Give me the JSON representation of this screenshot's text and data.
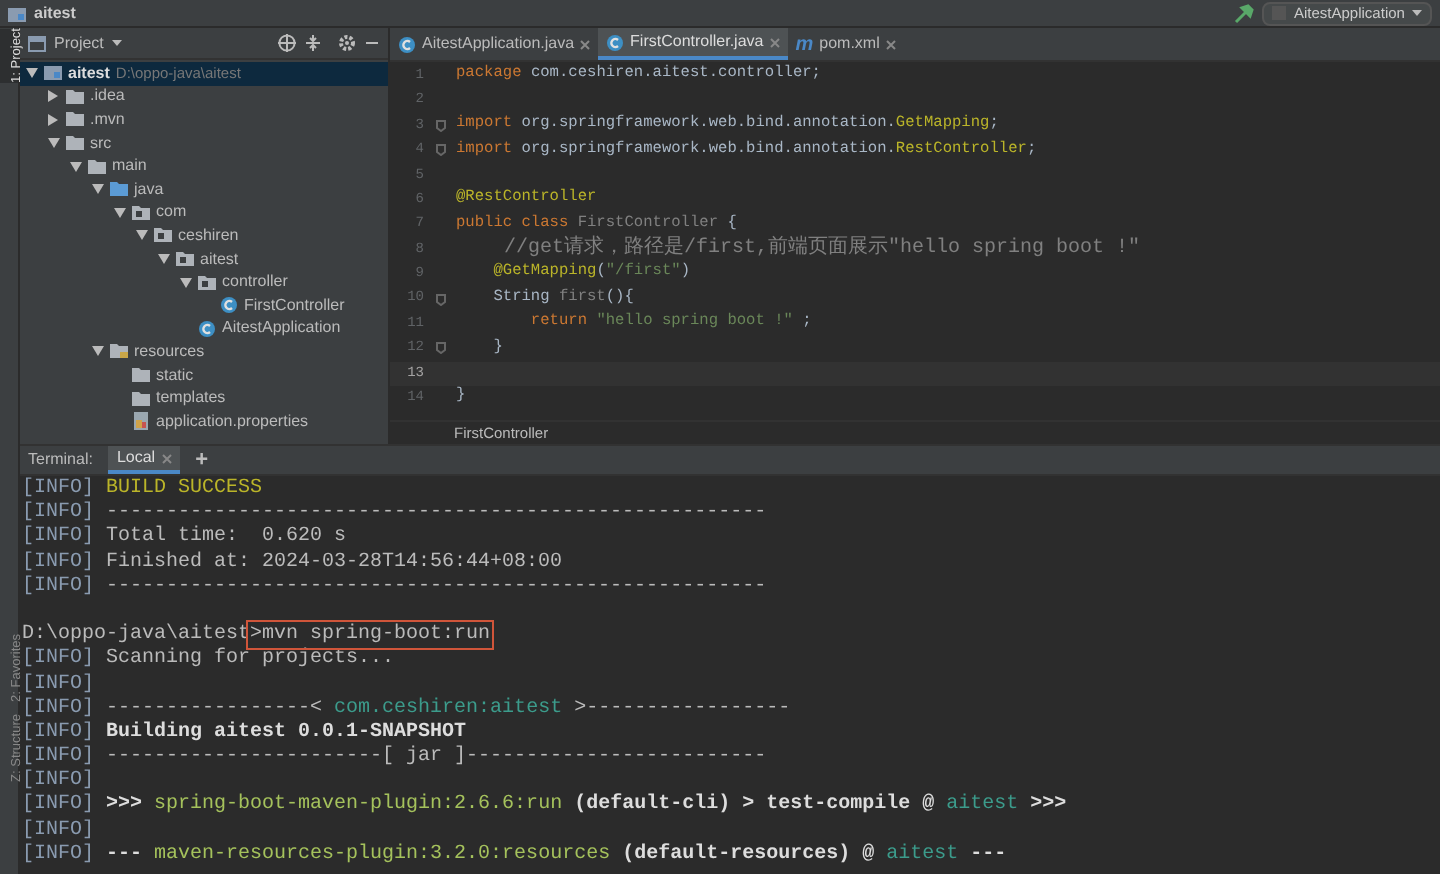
{
  "window": {
    "title": "aitest",
    "run_config": "AitestApplication"
  },
  "side_tabs": [
    {
      "label": "1: Project",
      "selected": true
    },
    {
      "label": "2: Favorites",
      "selected": false
    },
    {
      "label": "Z: Structure",
      "selected": false
    }
  ],
  "project_panel": {
    "title": "Project",
    "tree": [
      {
        "kind": "module",
        "label": "aitest",
        "path": "D:\\oppo-java\\aitest",
        "expanded": true,
        "selected": true,
        "children": [
          {
            "kind": "folder",
            "label": ".idea",
            "expanded": false,
            "selected": false
          },
          {
            "kind": "folder",
            "label": ".mvn",
            "expanded": false,
            "selected": false
          },
          {
            "kind": "folder",
            "label": "src",
            "expanded": true,
            "selected": false,
            "children": [
              {
                "kind": "folder",
                "label": "main",
                "expanded": true,
                "selected": false,
                "children": [
                  {
                    "kind": "source_folder",
                    "label": "java",
                    "expanded": true,
                    "selected": false,
                    "children": [
                      {
                        "kind": "package",
                        "label": "com",
                        "expanded": true,
                        "selected": false,
                        "children": [
                          {
                            "kind": "package",
                            "label": "ceshiren",
                            "expanded": true,
                            "selected": false,
                            "children": [
                              {
                                "kind": "package",
                                "label": "aitest",
                                "expanded": true,
                                "selected": false,
                                "children": [
                                  {
                                    "kind": "package",
                                    "label": "controller",
                                    "expanded": true,
                                    "selected": false,
                                    "children": [
                                      {
                                        "kind": "class",
                                        "label": "FirstController",
                                        "selected": false
                                      }
                                    ]
                                  },
                                  {
                                    "kind": "class",
                                    "label": "AitestApplication",
                                    "selected": false
                                  }
                                ]
                              }
                            ]
                          }
                        ]
                      }
                    ]
                  },
                  {
                    "kind": "resources_folder",
                    "label": "resources",
                    "expanded": true,
                    "selected": false,
                    "children": [
                      {
                        "kind": "folder",
                        "label": "static",
                        "selected": false
                      },
                      {
                        "kind": "folder",
                        "label": "templates",
                        "selected": false
                      },
                      {
                        "kind": "properties",
                        "label": "application.properties",
                        "selected": false
                      }
                    ]
                  }
                ]
              }
            ]
          }
        ]
      }
    ]
  },
  "editor": {
    "tabs": [
      {
        "kind": "class",
        "label": "AitestApplication.java",
        "selected": false
      },
      {
        "kind": "class",
        "label": "FirstController.java",
        "selected": true
      },
      {
        "kind": "maven",
        "glyph": "m",
        "label": "pom.xml",
        "selected": false
      }
    ],
    "lines": [
      {
        "number": "1",
        "current": false,
        "tokens": [
          {
            "kind": "keyword",
            "text": "package "
          },
          {
            "kind": "plain",
            "text": "com.ceshiren.aitest.controller;"
          }
        ]
      },
      {
        "number": "2",
        "current": false
      },
      {
        "number": "3",
        "current": false,
        "fold": true,
        "tokens": [
          {
            "kind": "keyword",
            "text": "import "
          },
          {
            "kind": "plain",
            "text": "org.springframework.web.bind.annotation."
          },
          {
            "kind": "annotation",
            "text": "GetMapping"
          },
          {
            "kind": "plain",
            "text": ";"
          }
        ]
      },
      {
        "number": "4",
        "current": false,
        "fold": true,
        "tokens": [
          {
            "kind": "keyword",
            "text": "import "
          },
          {
            "kind": "plain",
            "text": "org.springframework.web.bind.annotation."
          },
          {
            "kind": "annotation",
            "text": "RestController"
          },
          {
            "kind": "plain",
            "text": ";"
          }
        ]
      },
      {
        "number": "5",
        "current": false
      },
      {
        "number": "6",
        "current": false,
        "tokens": [
          {
            "kind": "annotation",
            "text": "@RestController"
          }
        ]
      },
      {
        "number": "7",
        "current": false,
        "tokens": [
          {
            "kind": "keyword",
            "text": "public class "
          },
          {
            "kind": "unused",
            "text": "FirstController "
          },
          {
            "kind": "plain",
            "text": "{"
          }
        ]
      },
      {
        "number": "8",
        "current": false,
        "tokens": [
          {
            "kind": "comment",
            "text": "    //get请求，路径是/first,前端页面展示\"hello spring boot !\""
          }
        ]
      },
      {
        "number": "9",
        "current": false,
        "tokens": [
          {
            "kind": "annotation",
            "text": "    @GetMapping"
          },
          {
            "kind": "plain",
            "text": "("
          },
          {
            "kind": "string",
            "text": "\"/first\""
          },
          {
            "kind": "plain",
            "text": ")"
          }
        ]
      },
      {
        "number": "10",
        "current": false,
        "fold": true,
        "tokens": [
          {
            "kind": "plain",
            "text": "    String "
          },
          {
            "kind": "unused",
            "text": "first"
          },
          {
            "kind": "plain",
            "text": "(){"
          }
        ]
      },
      {
        "number": "11",
        "current": false,
        "tokens": [
          {
            "kind": "keyword",
            "text": "        return "
          },
          {
            "kind": "string",
            "text": "\"hello spring boot !\""
          },
          {
            "kind": "plain",
            "text": " ;"
          }
        ]
      },
      {
        "number": "12",
        "current": false,
        "fold": true,
        "tokens": [
          {
            "kind": "plain",
            "text": "    }"
          }
        ]
      },
      {
        "number": "13",
        "current": true
      },
      {
        "number": "14",
        "current": false,
        "tokens": [
          {
            "kind": "plain",
            "text": "}"
          }
        ]
      }
    ],
    "breadcrumb": "FirstController"
  },
  "terminal": {
    "label": "Terminal:",
    "tabs": [
      {
        "label": "Local",
        "selected": true
      }
    ],
    "add": "+",
    "lines": [
      [
        {
          "kind": "info",
          "text": "[INFO]"
        },
        {
          "kind": "success",
          "text": " BUILD SUCCESS"
        }
      ],
      [
        {
          "kind": "info",
          "text": "[INFO]"
        },
        {
          "kind": "plain",
          "text": " -------------------------------------------------------"
        }
      ],
      [
        {
          "kind": "info",
          "text": "[INFO]"
        },
        {
          "kind": "plain",
          "text": " Total time:  0.620 s"
        }
      ],
      [
        {
          "kind": "info",
          "text": "[INFO]"
        },
        {
          "kind": "plain",
          "text": " Finished at: 2024-03-28T14:56:44+08:00"
        }
      ],
      [
        {
          "kind": "info",
          "text": "[INFO]"
        },
        {
          "kind": "plain",
          "text": " -------------------------------------------------------"
        }
      ],
      [
        {
          "kind": "blank"
        }
      ],
      [
        {
          "kind": "plain",
          "text": "D:\\oppo-java\\aitest"
        },
        {
          "kind": "boxed",
          "text": ">mvn spring-boot:run"
        }
      ],
      [
        {
          "kind": "info",
          "text": "[INFO]"
        },
        {
          "kind": "plain",
          "text": " Scanning for projects..."
        }
      ],
      [
        {
          "kind": "info",
          "text": "[INFO]"
        }
      ],
      [
        {
          "kind": "info",
          "text": "[INFO]"
        },
        {
          "kind": "plain",
          "text": " -----------------< "
        },
        {
          "kind": "module",
          "text": "com.ceshiren:aitest"
        },
        {
          "kind": "plain",
          "text": " >-----------------"
        }
      ],
      [
        {
          "kind": "info",
          "text": "[INFO]"
        },
        {
          "kind": "bold",
          "text": " Building aitest 0.0.1-SNAPSHOT"
        }
      ],
      [
        {
          "kind": "info",
          "text": "[INFO]"
        },
        {
          "kind": "plain",
          "text": " -----------------------[ jar ]-------------------------"
        }
      ],
      [
        {
          "kind": "info",
          "text": "[INFO]"
        }
      ],
      [
        {
          "kind": "info",
          "text": "[INFO]"
        },
        {
          "kind": "bold",
          "text": " >>> "
        },
        {
          "kind": "plugin",
          "text": "spring-boot-maven-plugin:2.6.6:run"
        },
        {
          "kind": "bold",
          "text": " (default-cli) > test-compile @ "
        },
        {
          "kind": "module",
          "text": "aitest"
        },
        {
          "kind": "bold",
          "text": " >>>"
        }
      ],
      [
        {
          "kind": "info",
          "text": "[INFO]"
        }
      ],
      [
        {
          "kind": "info",
          "text": "[INFO]"
        },
        {
          "kind": "bold",
          "text": " --- "
        },
        {
          "kind": "plugin",
          "text": "maven-resources-plugin:3.2.0:resources"
        },
        {
          "kind": "bold",
          "text": " (default-resources) @ "
        },
        {
          "kind": "module",
          "text": "aitest"
        },
        {
          "kind": "bold",
          "text": " ---"
        }
      ]
    ]
  }
}
